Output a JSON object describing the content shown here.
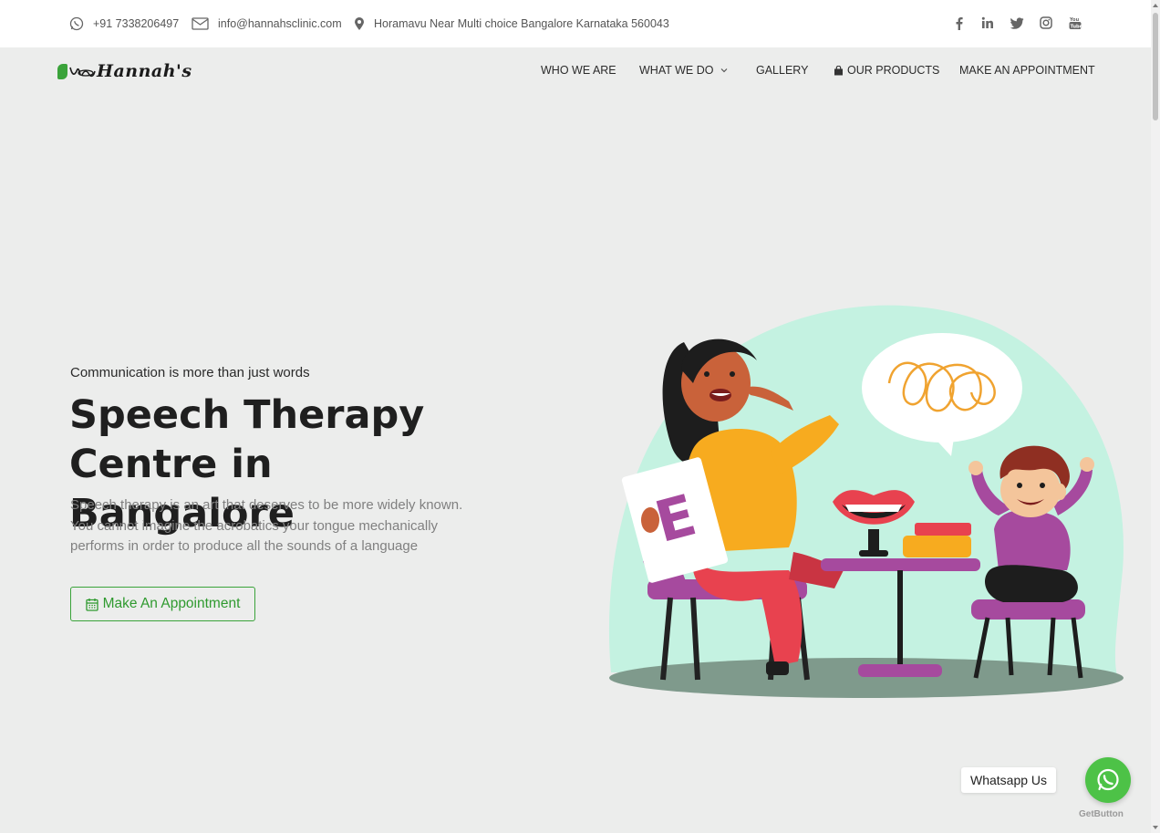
{
  "topbar": {
    "phone": "+91 7338206497",
    "email": "info@hannahsclinic.com",
    "address": "Horamavu Near Multi choice Bangalore Karnataka 560043",
    "social_icons": [
      "facebook-icon",
      "linkedin-icon",
      "twitter-icon",
      "instagram-icon",
      "youtube-icon"
    ]
  },
  "brand": {
    "logo_text": "Hannah's",
    "accent_color": "#3aa33a"
  },
  "nav": {
    "items": [
      {
        "label": "WHO WE ARE"
      },
      {
        "label": "WHAT WE DO"
      },
      {
        "label": "GALLERY"
      },
      {
        "label": "OUR PRODUCTS"
      },
      {
        "label": "MAKE AN APPOINTMENT"
      }
    ]
  },
  "hero": {
    "kicker": "Communication is more than just words",
    "title_line1": "Speech Therapy",
    "title_line2": "Centre in Bangalore",
    "description": "Speech therapy is an art that deserves to be more widely known. You cannot imagine the acrobatics your tongue mechanically performs in order to produce all the sounds of a language",
    "cta_label": "Make An Appointment",
    "card_letter": "E"
  },
  "whatsapp": {
    "label": "Whatsapp Us",
    "powered_by": "GetButton",
    "color": "#4dc247"
  }
}
